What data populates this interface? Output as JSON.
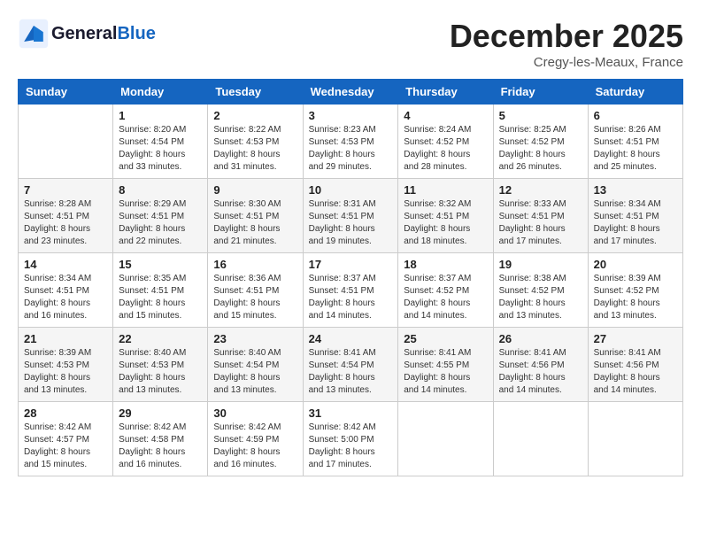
{
  "header": {
    "logo_line1": "General",
    "logo_line2": "Blue",
    "month": "December 2025",
    "location": "Cregy-les-Meaux, France"
  },
  "days_of_week": [
    "Sunday",
    "Monday",
    "Tuesday",
    "Wednesday",
    "Thursday",
    "Friday",
    "Saturday"
  ],
  "weeks": [
    [
      {
        "day": "",
        "info": ""
      },
      {
        "day": "1",
        "info": "Sunrise: 8:20 AM\nSunset: 4:54 PM\nDaylight: 8 hours\nand 33 minutes."
      },
      {
        "day": "2",
        "info": "Sunrise: 8:22 AM\nSunset: 4:53 PM\nDaylight: 8 hours\nand 31 minutes."
      },
      {
        "day": "3",
        "info": "Sunrise: 8:23 AM\nSunset: 4:53 PM\nDaylight: 8 hours\nand 29 minutes."
      },
      {
        "day": "4",
        "info": "Sunrise: 8:24 AM\nSunset: 4:52 PM\nDaylight: 8 hours\nand 28 minutes."
      },
      {
        "day": "5",
        "info": "Sunrise: 8:25 AM\nSunset: 4:52 PM\nDaylight: 8 hours\nand 26 minutes."
      },
      {
        "day": "6",
        "info": "Sunrise: 8:26 AM\nSunset: 4:51 PM\nDaylight: 8 hours\nand 25 minutes."
      }
    ],
    [
      {
        "day": "7",
        "info": "Sunrise: 8:28 AM\nSunset: 4:51 PM\nDaylight: 8 hours\nand 23 minutes."
      },
      {
        "day": "8",
        "info": "Sunrise: 8:29 AM\nSunset: 4:51 PM\nDaylight: 8 hours\nand 22 minutes."
      },
      {
        "day": "9",
        "info": "Sunrise: 8:30 AM\nSunset: 4:51 PM\nDaylight: 8 hours\nand 21 minutes."
      },
      {
        "day": "10",
        "info": "Sunrise: 8:31 AM\nSunset: 4:51 PM\nDaylight: 8 hours\nand 19 minutes."
      },
      {
        "day": "11",
        "info": "Sunrise: 8:32 AM\nSunset: 4:51 PM\nDaylight: 8 hours\nand 18 minutes."
      },
      {
        "day": "12",
        "info": "Sunrise: 8:33 AM\nSunset: 4:51 PM\nDaylight: 8 hours\nand 17 minutes."
      },
      {
        "day": "13",
        "info": "Sunrise: 8:34 AM\nSunset: 4:51 PM\nDaylight: 8 hours\nand 17 minutes."
      }
    ],
    [
      {
        "day": "14",
        "info": "Sunrise: 8:34 AM\nSunset: 4:51 PM\nDaylight: 8 hours\nand 16 minutes."
      },
      {
        "day": "15",
        "info": "Sunrise: 8:35 AM\nSunset: 4:51 PM\nDaylight: 8 hours\nand 15 minutes."
      },
      {
        "day": "16",
        "info": "Sunrise: 8:36 AM\nSunset: 4:51 PM\nDaylight: 8 hours\nand 15 minutes."
      },
      {
        "day": "17",
        "info": "Sunrise: 8:37 AM\nSunset: 4:51 PM\nDaylight: 8 hours\nand 14 minutes."
      },
      {
        "day": "18",
        "info": "Sunrise: 8:37 AM\nSunset: 4:52 PM\nDaylight: 8 hours\nand 14 minutes."
      },
      {
        "day": "19",
        "info": "Sunrise: 8:38 AM\nSunset: 4:52 PM\nDaylight: 8 hours\nand 13 minutes."
      },
      {
        "day": "20",
        "info": "Sunrise: 8:39 AM\nSunset: 4:52 PM\nDaylight: 8 hours\nand 13 minutes."
      }
    ],
    [
      {
        "day": "21",
        "info": "Sunrise: 8:39 AM\nSunset: 4:53 PM\nDaylight: 8 hours\nand 13 minutes."
      },
      {
        "day": "22",
        "info": "Sunrise: 8:40 AM\nSunset: 4:53 PM\nDaylight: 8 hours\nand 13 minutes."
      },
      {
        "day": "23",
        "info": "Sunrise: 8:40 AM\nSunset: 4:54 PM\nDaylight: 8 hours\nand 13 minutes."
      },
      {
        "day": "24",
        "info": "Sunrise: 8:41 AM\nSunset: 4:54 PM\nDaylight: 8 hours\nand 13 minutes."
      },
      {
        "day": "25",
        "info": "Sunrise: 8:41 AM\nSunset: 4:55 PM\nDaylight: 8 hours\nand 14 minutes."
      },
      {
        "day": "26",
        "info": "Sunrise: 8:41 AM\nSunset: 4:56 PM\nDaylight: 8 hours\nand 14 minutes."
      },
      {
        "day": "27",
        "info": "Sunrise: 8:41 AM\nSunset: 4:56 PM\nDaylight: 8 hours\nand 14 minutes."
      }
    ],
    [
      {
        "day": "28",
        "info": "Sunrise: 8:42 AM\nSunset: 4:57 PM\nDaylight: 8 hours\nand 15 minutes."
      },
      {
        "day": "29",
        "info": "Sunrise: 8:42 AM\nSunset: 4:58 PM\nDaylight: 8 hours\nand 16 minutes."
      },
      {
        "day": "30",
        "info": "Sunrise: 8:42 AM\nSunset: 4:59 PM\nDaylight: 8 hours\nand 16 minutes."
      },
      {
        "day": "31",
        "info": "Sunrise: 8:42 AM\nSunset: 5:00 PM\nDaylight: 8 hours\nand 17 minutes."
      },
      {
        "day": "",
        "info": ""
      },
      {
        "day": "",
        "info": ""
      },
      {
        "day": "",
        "info": ""
      }
    ]
  ]
}
